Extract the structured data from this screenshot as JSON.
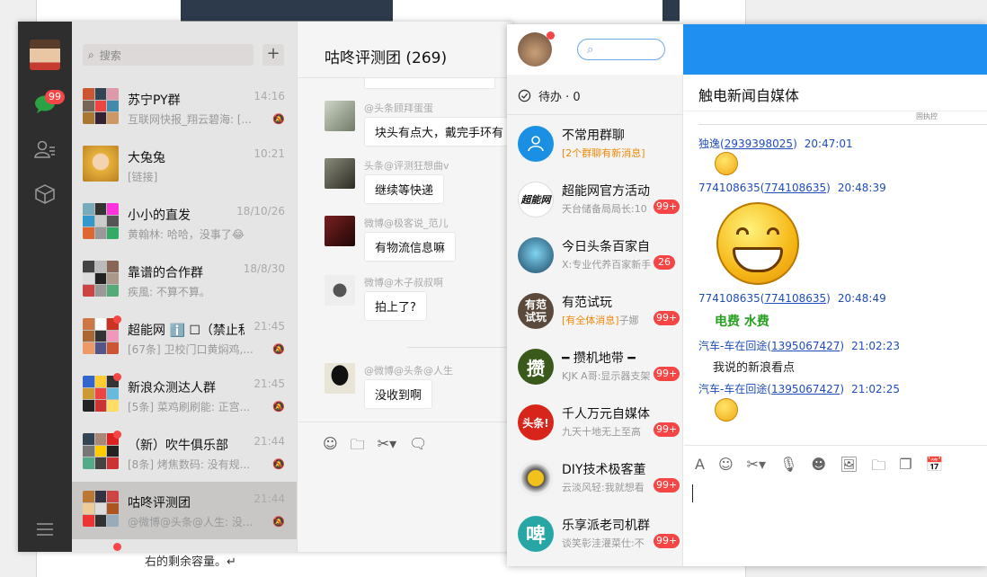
{
  "background": {
    "doc_text": "右的剩余容量。↵"
  },
  "wechat": {
    "nav": {
      "unread_badge": "99"
    },
    "search": {
      "placeholder": "搜索",
      "add_label": "+"
    },
    "conversations": [
      {
        "name": "苏宁PY群",
        "time": "14:16",
        "preview": "互联网快报_翔云碧海: [...",
        "muted": true,
        "dot": false
      },
      {
        "name": "大兔兔",
        "time": "10:21",
        "preview": "[链接]",
        "muted": false,
        "dot": false
      },
      {
        "name": "小小的直发",
        "time": "18/10/26",
        "preview": "黄翰林: 哈哈，没事了😂",
        "muted": false,
        "dot": false
      },
      {
        "name": "靠谱的合作群",
        "time": "18/8/30",
        "preview": "疾風: 不算不算。",
        "muted": false,
        "dot": false
      },
      {
        "name": "超能网 ℹ️ ☐（禁止私...",
        "time": "21:45",
        "preview": "[67条] 卫校门口黄焖鸡,...",
        "muted": true,
        "dot": true
      },
      {
        "name": "新浪众测达人群",
        "time": "21:45",
        "preview": "[5条] 菜鸡刷刷能: 正宫...",
        "muted": true,
        "dot": true
      },
      {
        "name": "（新）吹牛俱乐部",
        "time": "21:44",
        "preview": "[8条] 烤焦数码: 没有规...",
        "muted": true,
        "dot": true
      },
      {
        "name": "咕咚评测团",
        "time": "21:44",
        "preview": "@微博@头条@人生: 没...",
        "muted": true,
        "dot": false
      }
    ],
    "chat": {
      "title": "咕咚评测团 (269)",
      "messages": [
        {
          "sender": "@头条顾拜蛋蛋",
          "text": "块头有点大，戴完手环有"
        },
        {
          "sender": "头条@评测狂想曲v",
          "text": "继续等快递"
        },
        {
          "sender": "微博@极客说_范儿",
          "text": "有物流信息嘛"
        },
        {
          "sender": "微博@木子叔叔啊",
          "text": "拍上了?"
        },
        {
          "sender": "@微博@头条@人生",
          "text": "没收到啊"
        }
      ]
    }
  },
  "qq": {
    "todo_label": "待办 · 0",
    "contacts": [
      {
        "name": "不常用群聊",
        "preview_highlight": "[2个群聊有新消息]",
        "preview": "",
        "badge": "",
        "avatar": "👥",
        "color": "#1a8fe3"
      },
      {
        "name": "超能网官方活动",
        "preview_highlight": "",
        "preview": "天台储备局局长:10",
        "badge": "99+",
        "avatar": "超能网",
        "color": "#ffffff"
      },
      {
        "name": "今日头条百家自",
        "preview_highlight": "",
        "preview": "X:专业代养百家新手",
        "badge": "26",
        "avatar": "",
        "color": "#2a5b7a"
      },
      {
        "name": "有范试玩",
        "preview_highlight": "[有全体消息]",
        "preview": "子娜",
        "badge": "99+",
        "avatar": "有范试玩",
        "color": "#5b4a3c"
      },
      {
        "name": "━ 攒机地带 ━",
        "preview_highlight": "",
        "preview": "KJK  A哥:显示器支架",
        "badge": "99+",
        "avatar": "攒",
        "color": "#3a5a1c"
      },
      {
        "name": "千人万元自媒体",
        "preview_highlight": "",
        "preview": "九天十地无上至高",
        "badge": "99+",
        "avatar": "头条!",
        "color": "#d8251c"
      },
      {
        "name": "DIY技术极客董",
        "preview_highlight": "",
        "preview": "云淡风轻:我就想看",
        "badge": "99+",
        "avatar": "",
        "color": "#f2c21c"
      },
      {
        "name": "乐享派老司机群",
        "preview_highlight": "",
        "preview": "谈笑彰洼灌菜仕:不",
        "badge": "99+",
        "avatar": "啤",
        "color": "#28a6a6"
      }
    ],
    "chat": {
      "title": "触电新闻自媒体",
      "fragment_text": "固执控",
      "messages": [
        {
          "sender_name": "独逸",
          "sender_id": "2939398025",
          "time": "20:47:01",
          "kind": "emoji-small"
        },
        {
          "sender_name": "774108635",
          "sender_id": "774108635",
          "time": "20:48:39",
          "kind": "emoji-large"
        },
        {
          "sender_name": "774108635",
          "sender_id": "774108635",
          "time": "20:48:49",
          "kind": "green",
          "text": "电费 水费"
        },
        {
          "sender_name": "汽车-车在回途",
          "sender_id": "1395067427",
          "time": "21:02:23",
          "kind": "text",
          "text": "我说的新浪看点"
        },
        {
          "sender_name": "汽车-车在回途",
          "sender_id": "1395067427",
          "time": "21:02:25",
          "kind": "emoji-small"
        }
      ]
    }
  }
}
